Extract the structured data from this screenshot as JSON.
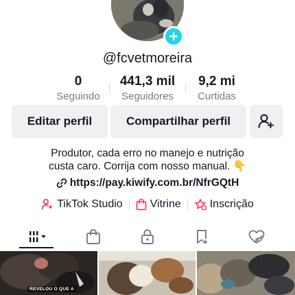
{
  "profile": {
    "username": "@fcvetmoreira",
    "accent_color": "#20d5ec"
  },
  "stats": {
    "following": {
      "value": "0",
      "label": "Seguindo"
    },
    "followers": {
      "value": "441,3 mil",
      "label": "Seguidores"
    },
    "likes": {
      "value": "9,2 mi",
      "label": "Curtidas"
    }
  },
  "actions": {
    "edit_label": "Editar perfil",
    "share_label": "Compartilhar perfil",
    "add_friend_icon": "person-add-icon"
  },
  "bio": {
    "line1": "Produtor, cada erro no manejo e nutrição",
    "line2": "custa caro. Corrija com nosso manual.",
    "emoji": "👇"
  },
  "link": {
    "icon": "link-icon",
    "url": "https://pay.kiwify.com.br/NfrGQtH"
  },
  "shortcuts": [
    {
      "label": "TikTok Studio",
      "icon": "studio-icon",
      "color": "#fe2c55"
    },
    {
      "label": "Vitrine",
      "icon": "shopping-bag-icon",
      "color": "#fe2c55"
    },
    {
      "label": "Inscrição",
      "icon": "subscription-icon",
      "color": "#fe2c55"
    }
  ],
  "tabs": [
    {
      "name": "videos",
      "icon": "grid-icon",
      "active": true
    },
    {
      "name": "shop",
      "icon": "bag-icon"
    },
    {
      "name": "private",
      "icon": "lock-icon"
    },
    {
      "name": "reposts",
      "icon": "repost-icon"
    },
    {
      "name": "liked",
      "icon": "heart-hidden-icon"
    }
  ],
  "videos": [
    {
      "caption": "REVELOU O QUE A"
    },
    {
      "caption": ""
    },
    {
      "caption": ""
    }
  ]
}
